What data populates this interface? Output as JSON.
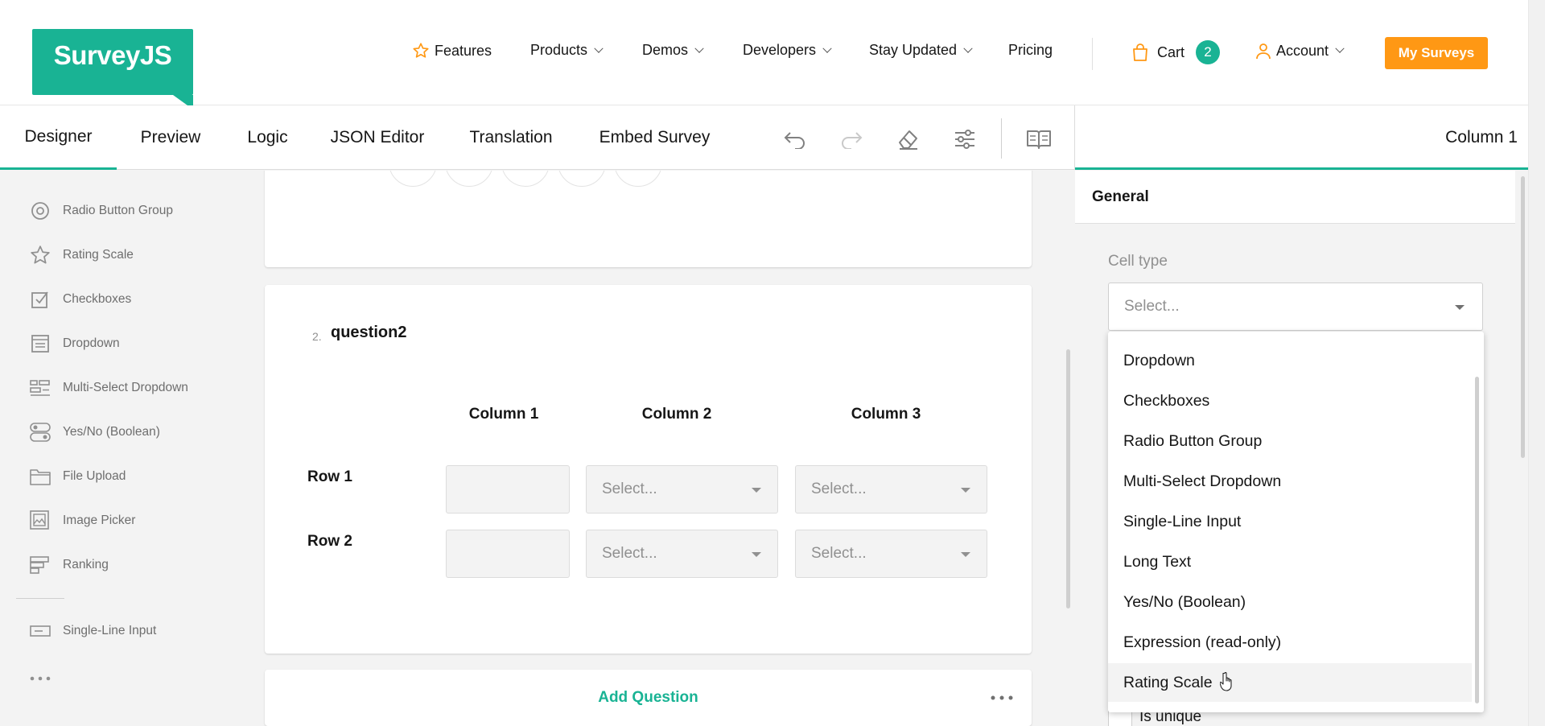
{
  "site": {
    "logo_text": "SurveyJS",
    "brand_color": "#19b394",
    "accent_color": "#ff9814",
    "nav": {
      "features": "Features",
      "products": "Products",
      "demos": "Demos",
      "developers": "Developers",
      "stay_updated": "Stay Updated",
      "pricing": "Pricing",
      "cart": "Cart",
      "cart_count": "2",
      "account": "Account",
      "my_surveys": "My Surveys"
    }
  },
  "creator": {
    "tabs": {
      "designer": "Designer",
      "preview": "Preview",
      "logic": "Logic",
      "json_editor": "JSON Editor",
      "translation": "Translation",
      "embed": "Embed Survey"
    },
    "active_tab": "Designer",
    "tools": [
      "undo-icon",
      "redo-icon",
      "eraser-icon",
      "settings-sliders-icon",
      "book-icon"
    ],
    "right_panel_title": "Column 1"
  },
  "toolbox": {
    "items": [
      {
        "label": "Radio Button Group",
        "icon": "radio-icon"
      },
      {
        "label": "Rating Scale",
        "icon": "star-icon"
      },
      {
        "label": "Checkboxes",
        "icon": "checkbox-icon"
      },
      {
        "label": "Dropdown",
        "icon": "dropdown-icon"
      },
      {
        "label": "Multi-Select Dropdown",
        "icon": "multi-select-icon"
      },
      {
        "label": "Yes/No (Boolean)",
        "icon": "boolean-icon"
      },
      {
        "label": "File Upload",
        "icon": "folder-icon"
      },
      {
        "label": "Image Picker",
        "icon": "image-icon"
      },
      {
        "label": "Ranking",
        "icon": "ranking-icon"
      },
      {
        "label": "Single-Line Input",
        "icon": "text-input-icon"
      }
    ]
  },
  "question2": {
    "number": "2.",
    "title": "question2",
    "columns": [
      "Column 1",
      "Column 2",
      "Column 3"
    ],
    "rows": [
      "Row 1",
      "Row 2"
    ],
    "select_placeholder": "Select..."
  },
  "add_question": "Add Question",
  "properties": {
    "section": "General",
    "cell_type_label": "Cell type",
    "cell_type_placeholder": "Select...",
    "is_unique_label": "Is unique",
    "dropdown_options": [
      "Dropdown",
      "Checkboxes",
      "Radio Button Group",
      "Multi-Select Dropdown",
      "Single-Line Input",
      "Long Text",
      "Yes/No (Boolean)",
      "Expression (read-only)",
      "Rating Scale"
    ],
    "hovered_option": "Rating Scale"
  }
}
